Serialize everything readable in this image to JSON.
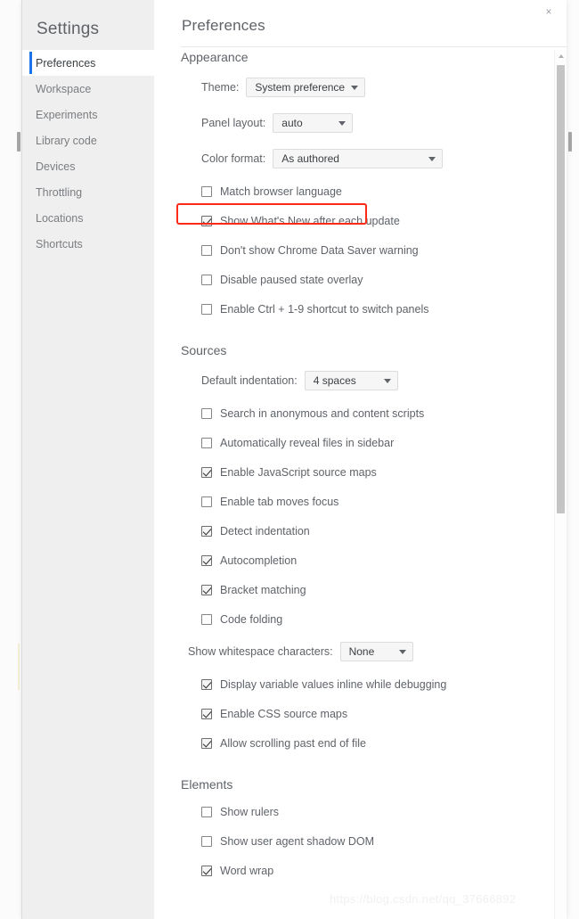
{
  "window": {
    "close_label": "×"
  },
  "sidebar": {
    "title": "Settings",
    "items": [
      {
        "label": "Preferences",
        "selected": true
      },
      {
        "label": "Workspace",
        "selected": false
      },
      {
        "label": "Experiments",
        "selected": false
      },
      {
        "label": "Library code",
        "selected": false
      },
      {
        "label": "Devices",
        "selected": false
      },
      {
        "label": "Throttling",
        "selected": false
      },
      {
        "label": "Locations",
        "selected": false
      },
      {
        "label": "Shortcuts",
        "selected": false
      }
    ]
  },
  "pane": {
    "title": "Preferences"
  },
  "appearance": {
    "title": "Appearance",
    "theme_label": "Theme:",
    "theme_value": "System preference",
    "panel_label": "Panel layout:",
    "panel_value": "auto",
    "color_label": "Color format:",
    "color_value": "As authored",
    "checkboxes": [
      {
        "label": "Match browser language",
        "checked": false
      },
      {
        "label": "Show What's New after each update",
        "checked": true
      },
      {
        "label": "Don't show Chrome Data Saver warning",
        "checked": false
      },
      {
        "label": "Disable paused state overlay",
        "checked": false
      },
      {
        "label": "Enable Ctrl + 1-9 shortcut to switch panels",
        "checked": false
      }
    ]
  },
  "sources": {
    "title": "Sources",
    "indent_label": "Default indentation:",
    "indent_value": "4 spaces",
    "checkboxes_top": [
      {
        "label": "Search in anonymous and content scripts",
        "checked": false
      },
      {
        "label": "Automatically reveal files in sidebar",
        "checked": false
      },
      {
        "label": "Enable JavaScript source maps",
        "checked": true
      },
      {
        "label": "Enable tab moves focus",
        "checked": false
      },
      {
        "label": "Detect indentation",
        "checked": true
      },
      {
        "label": "Autocompletion",
        "checked": true
      },
      {
        "label": "Bracket matching",
        "checked": true
      },
      {
        "label": "Code folding",
        "checked": false
      }
    ],
    "whitespace_label": "Show whitespace characters:",
    "whitespace_value": "None",
    "checkboxes_bottom": [
      {
        "label": "Display variable values inline while debugging",
        "checked": true
      },
      {
        "label": "Enable CSS source maps",
        "checked": true
      },
      {
        "label": "Allow scrolling past end of file",
        "checked": true
      }
    ]
  },
  "elements": {
    "title": "Elements",
    "checkboxes": [
      {
        "label": "Show rulers",
        "checked": false
      },
      {
        "label": "Show user agent shadow DOM",
        "checked": false
      },
      {
        "label": "Word wrap",
        "checked": true
      }
    ]
  },
  "watermark": {
    "text": "https://blog.csdn.net/qq_37666892"
  },
  "colors": {
    "accent": "#1a73e8",
    "highlight": "#fc2a16",
    "sidebar_bg": "#efefef",
    "text": "#5f6368"
  }
}
